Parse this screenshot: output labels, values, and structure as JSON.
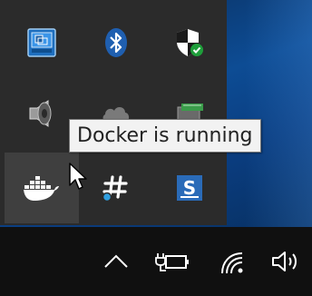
{
  "tooltip": {
    "text": "Docker is running"
  },
  "tray_icons": [
    {
      "name": "intel-graphics-icon"
    },
    {
      "name": "bluetooth-icon"
    },
    {
      "name": "windows-defender-icon"
    },
    {
      "name": "speaker-device-icon"
    },
    {
      "name": "onedrive-icon"
    },
    {
      "name": "safely-remove-hardware-icon"
    },
    {
      "name": "docker-icon"
    },
    {
      "name": "slack-icon"
    },
    {
      "name": "sonar-icon"
    }
  ],
  "taskbar_icons": [
    {
      "name": "show-hidden-icons-chevron"
    },
    {
      "name": "power-plugged-icon"
    },
    {
      "name": "network-wifi-icon"
    },
    {
      "name": "volume-icon"
    }
  ],
  "colors": {
    "panel": "#2b2b2b",
    "taskbar": "#101010",
    "hover": "#3f3f3f",
    "desktop": "#0d4c94"
  }
}
